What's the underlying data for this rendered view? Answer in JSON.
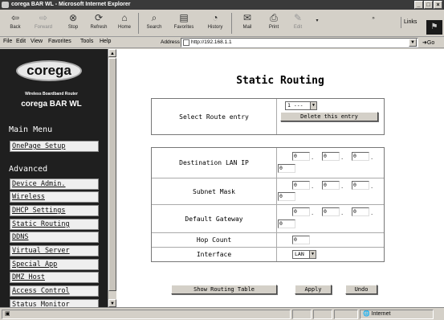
{
  "window": {
    "title": "corega BAR WL - Microsoft Internet Explorer",
    "controls": [
      "_",
      "□",
      "×"
    ]
  },
  "toolbar": {
    "back": "Back",
    "forward": "Forward",
    "stop": "Stop",
    "refresh": "Refresh",
    "home": "Home",
    "search": "Search",
    "favorites": "Favorites",
    "history": "History",
    "mail": "Mail",
    "print": "Print",
    "edit": "Edit",
    "links": "Links",
    "more": "»"
  },
  "menubar": {
    "items": [
      "File",
      "Edit",
      "View",
      "Favorites",
      "Tools",
      "Help"
    ],
    "address_label": "Address",
    "address_value": "http://192.168.1.1",
    "go_label": "Go"
  },
  "sidebar": {
    "logo": "corega",
    "product_subtitle": "Wireless Boardband Router",
    "product_name": "corega BAR WL",
    "main_menu_heading": "Main Menu",
    "main_links": [
      "OnePage Setup"
    ],
    "advanced_heading": "Advanced",
    "advanced_links": [
      "Device Admin.",
      "Wireless",
      "DHCP Settings",
      "Static Routing",
      "DDNS",
      "Virtual Server",
      "Special App",
      "DMZ Host",
      "Access Control",
      "Status Monitor"
    ]
  },
  "page": {
    "title": "Static Routing",
    "select_route_label": "Select Route entry",
    "route_entry_selected": "1 ---",
    "delete_button": "Delete this entry",
    "dest_lan_ip_label": "Destination LAN IP",
    "dest_lan_ip": [
      "0",
      "0",
      "0",
      "0"
    ],
    "subnet_mask_label": "Subnet Mask",
    "subnet_mask": [
      "0",
      "0",
      "0",
      "0"
    ],
    "default_gateway_label": "Default Gateway",
    "default_gateway": [
      "0",
      "0",
      "0",
      "0"
    ],
    "hop_count_label": "Hop Count",
    "hop_count": "0",
    "interface_label": "Interface",
    "interface_selected": "LAN",
    "dot": ".",
    "show_table_button": "Show Routing Table",
    "apply_button": "Apply",
    "undo_button": "Undo"
  },
  "statusbar": {
    "zone": "Internet"
  }
}
